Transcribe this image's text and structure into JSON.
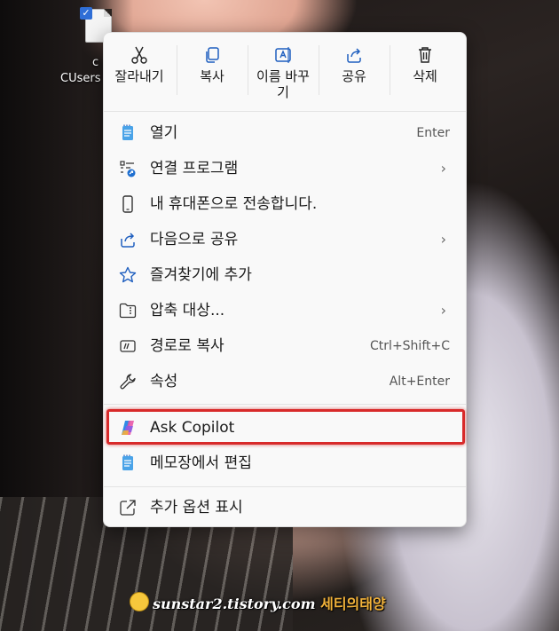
{
  "desktop": {
    "file_label_line1": "c",
    "file_label_line2": "CUsers"
  },
  "toolbar": {
    "cut": {
      "label": "잘라내기",
      "icon": "scissors-icon"
    },
    "copy": {
      "label": "복사",
      "icon": "copy-icon"
    },
    "rename": {
      "label": "이름 바꾸\n기",
      "icon": "rename-icon"
    },
    "share": {
      "label": "공유",
      "icon": "share-icon"
    },
    "delete": {
      "label": "삭제",
      "icon": "trash-icon"
    }
  },
  "items": [
    {
      "label": "열기",
      "shortcut": "Enter",
      "icon": "notepad-icon"
    },
    {
      "label": "연결 프로그램",
      "submenu": true,
      "icon": "open-with-icon"
    },
    {
      "label": "내 휴대폰으로 전송합니다.",
      "icon": "phone-icon"
    },
    {
      "label": "다음으로 공유",
      "submenu": true,
      "icon": "share-icon"
    },
    {
      "label": "즐겨찾기에 추가",
      "icon": "star-icon"
    },
    {
      "label": "압축 대상...",
      "submenu": true,
      "icon": "zip-folder-icon"
    },
    {
      "label": "경로로 복사",
      "shortcut": "Ctrl+Shift+C",
      "icon": "path-icon"
    },
    {
      "label": "속성",
      "shortcut": "Alt+Enter",
      "icon": "wrench-icon"
    },
    {
      "label": "Ask Copilot",
      "icon": "copilot-icon",
      "highlighted": true
    },
    {
      "label": "메모장에서 편집",
      "icon": "notepad-icon"
    },
    {
      "label": "추가 옵션 표시",
      "icon": "show-more-icon"
    }
  ],
  "chevron": "›",
  "highlight_color": "#d82a2a",
  "watermark": {
    "site": "sunstar2.tistory.com",
    "brand": "세티의태양"
  }
}
